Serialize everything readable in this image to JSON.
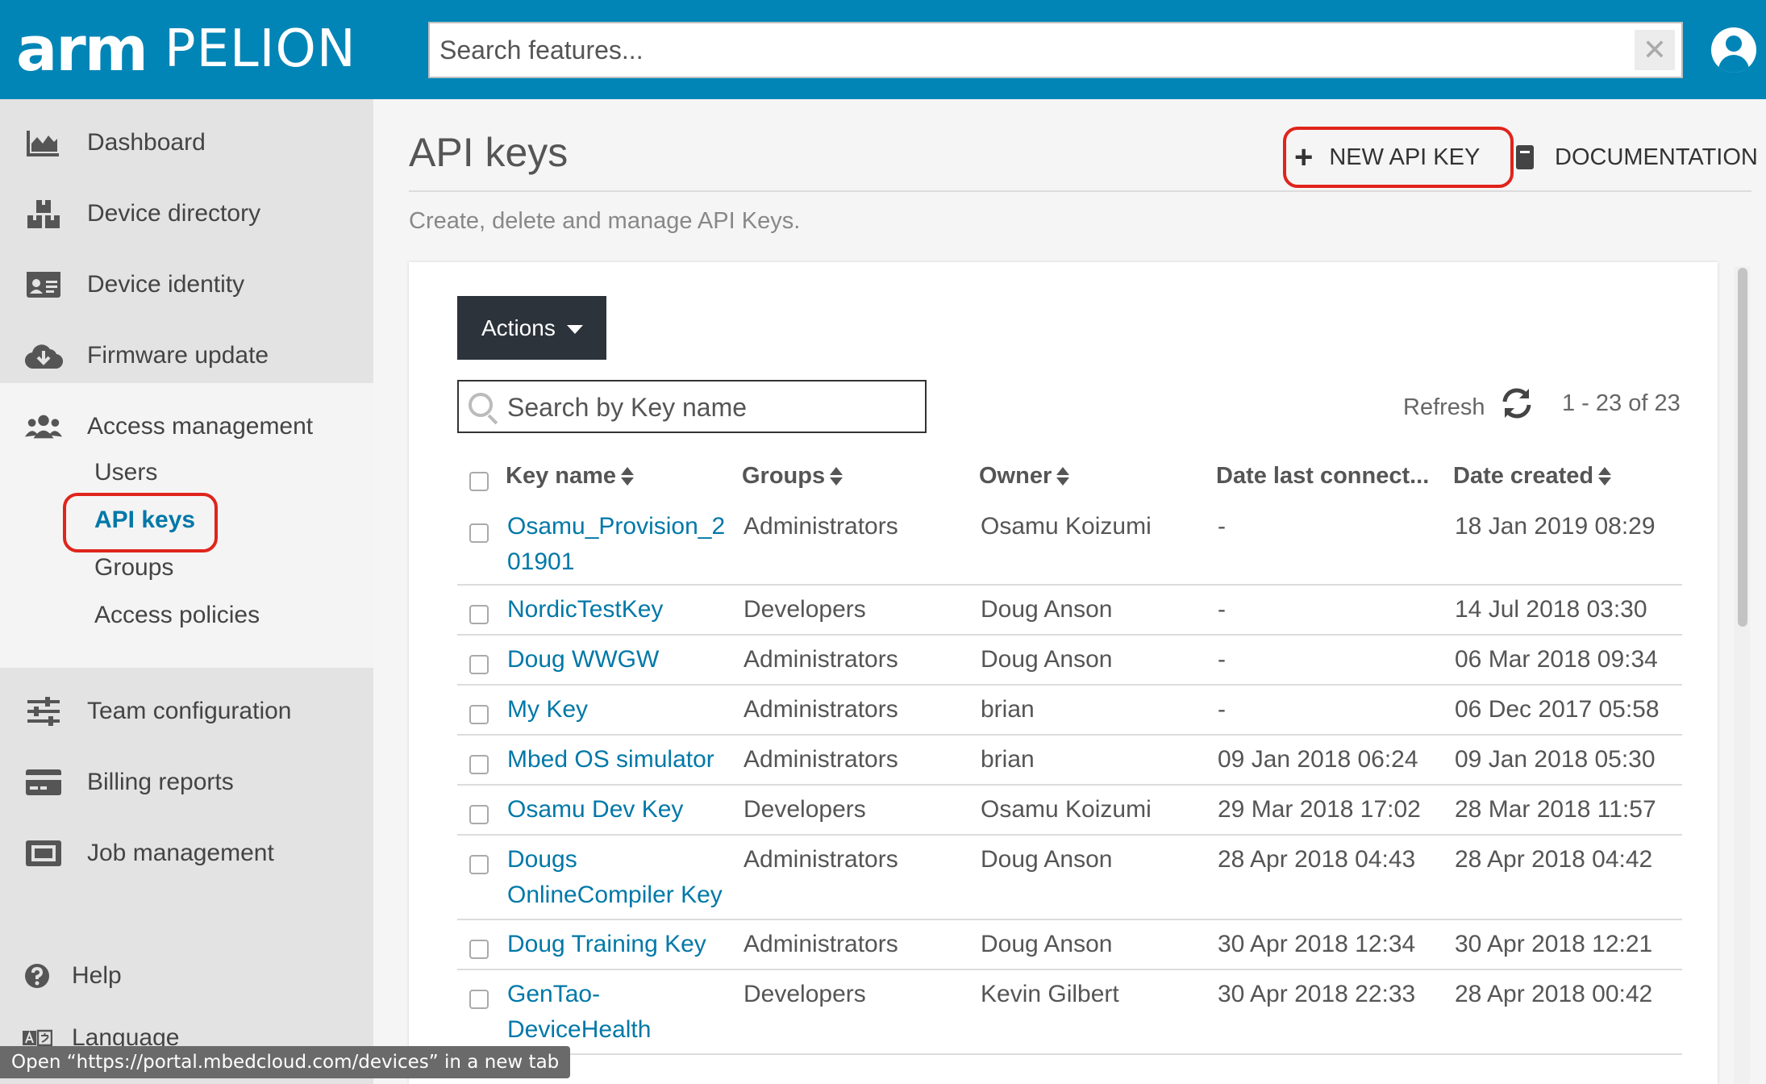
{
  "header": {
    "logo_arm": "arm",
    "logo_pelion": "PELION",
    "search_placeholder": "Search features...",
    "clear_glyph": "✕"
  },
  "sidebar": {
    "items": [
      {
        "label": "Dashboard",
        "icon": "chart-area-icon"
      },
      {
        "label": "Device directory",
        "icon": "boxes-icon"
      },
      {
        "label": "Device identity",
        "icon": "id-card-icon"
      },
      {
        "label": "Firmware update",
        "icon": "cloud-download-icon"
      },
      {
        "label": "Access management",
        "icon": "users-icon"
      }
    ],
    "access_sub": [
      {
        "label": "Users"
      },
      {
        "label": "API keys"
      },
      {
        "label": "Groups"
      },
      {
        "label": "Access policies"
      }
    ],
    "lower_items": [
      {
        "label": "Team configuration",
        "icon": "sliders-icon"
      },
      {
        "label": "Billing reports",
        "icon": "credit-card-icon"
      },
      {
        "label": "Job management",
        "icon": "job-icon"
      }
    ],
    "help": {
      "label": "Help",
      "icon": "question-circle-icon"
    },
    "language": {
      "label": "Language",
      "icon": "language-icon"
    }
  },
  "main": {
    "title": "API keys",
    "subtitle": "Create, delete and manage API Keys.",
    "new_button": "NEW API KEY",
    "doc_button": "DOCUMENTATION",
    "actions_button": "Actions",
    "search_placeholder": "Search by Key name",
    "refresh_label": "Refresh",
    "pager": "1 - 23 of 23"
  },
  "table": {
    "columns": [
      "Key name",
      "Groups",
      "Owner",
      "Date last connect...",
      "Date created"
    ],
    "rows": [
      {
        "key": "Osamu_Provision_2\n01901",
        "group": "Administrators",
        "owner": "Osamu Koizumi",
        "last": "-",
        "created": "18 Jan 2019 08:29"
      },
      {
        "key": "NordicTestKey",
        "group": "Developers",
        "owner": "Doug Anson",
        "last": "-",
        "created": "14 Jul 2018 03:30"
      },
      {
        "key": "Doug WWGW",
        "group": "Administrators",
        "owner": "Doug Anson",
        "last": "-",
        "created": "06 Mar 2018 09:34"
      },
      {
        "key": "My Key",
        "group": "Administrators",
        "owner": "brian",
        "last": "-",
        "created": "06 Dec 2017 05:58"
      },
      {
        "key": "Mbed OS simulator",
        "group": "Administrators",
        "owner": "brian",
        "last": "09 Jan 2018 06:24",
        "created": "09 Jan 2018 05:30"
      },
      {
        "key": "Osamu Dev Key",
        "group": "Developers",
        "owner": "Osamu Koizumi",
        "last": "29 Mar 2018 17:02",
        "created": "28 Mar 2018 11:57"
      },
      {
        "key": "Dougs\nOnlineCompiler Key",
        "group": "Administrators",
        "owner": "Doug Anson",
        "last": "28 Apr 2018 04:43",
        "created": "28 Apr 2018 04:42"
      },
      {
        "key": "Doug Training Key",
        "group": "Administrators",
        "owner": "Doug Anson",
        "last": "30 Apr 2018 12:34",
        "created": "30 Apr 2018 12:21"
      },
      {
        "key": "GenTao-\nDeviceHealth",
        "group": "Developers",
        "owner": "Kevin Gilbert",
        "last": "30 Apr 2018 22:33",
        "created": "28 Apr 2018 00:42"
      }
    ]
  },
  "status_tooltip": "Open “https://portal.mbedcloud.com/devices” in a new tab",
  "colors": {
    "header_bg": "#0085b6",
    "link": "#0078a8",
    "highlight": "#e0241b",
    "actions_bg": "#2c333b"
  }
}
